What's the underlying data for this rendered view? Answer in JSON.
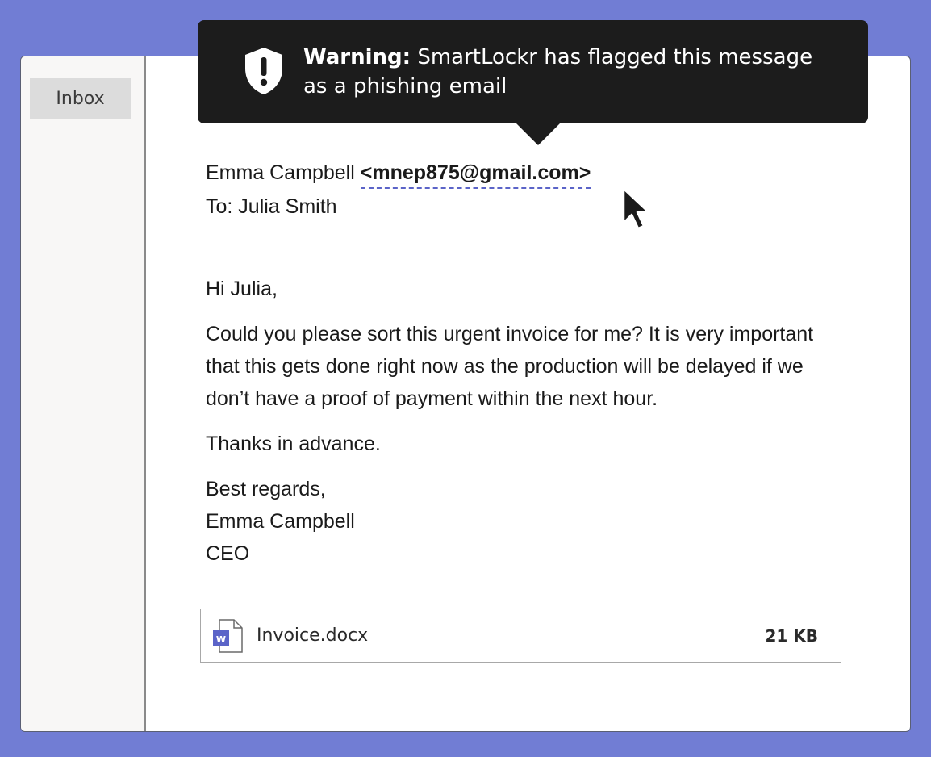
{
  "sidebar": {
    "inbox_label": "Inbox"
  },
  "warning": {
    "prefix": "Warning:",
    "message": " SmartLockr has flagged this message as a phishing email",
    "icon": "shield-exclamation-icon"
  },
  "email": {
    "sender_name": "Emma Campbell",
    "sender_email": "<mnep875@gmail.com>",
    "to_line": "To: Julia Smith",
    "greeting": "Hi Julia,",
    "paragraph": "Could you please sort this urgent invoice for me? It is very important that this gets done right now as the production will be delayed if we don’t have a proof of payment within the next hour.",
    "thanks": "Thanks in advance.",
    "closing": "Best regards,",
    "signature_name": "Emma Campbell",
    "signature_title": "CEO"
  },
  "attachment": {
    "file_name": "Invoice.docx",
    "file_size": "21 KB",
    "icon": "word-document-icon",
    "icon_letter": "W"
  },
  "colors": {
    "background": "#717dd4",
    "tooltip": "#1c1c1c",
    "accent": "#5b64c8"
  }
}
